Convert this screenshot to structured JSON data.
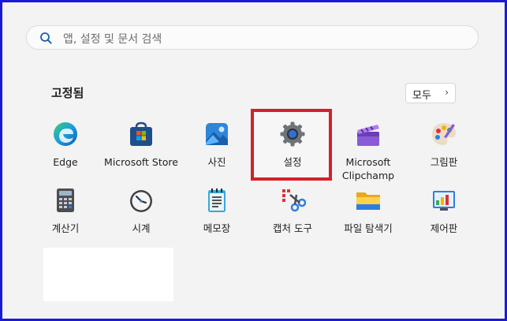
{
  "search": {
    "placeholder": "앱, 설정 및 문서 검색",
    "icon": "search-icon"
  },
  "pinned": {
    "title": "고정됨",
    "all_label": "모두",
    "apps": [
      {
        "label": "Edge",
        "icon": "edge-icon"
      },
      {
        "label": "Microsoft Store",
        "icon": "store-icon"
      },
      {
        "label": "사진",
        "icon": "photos-icon"
      },
      {
        "label": "설정",
        "icon": "gear-icon"
      },
      {
        "label_line1": "Microsoft",
        "label_line2": "Clipchamp",
        "icon": "clipchamp-icon"
      },
      {
        "label": "그림판",
        "icon": "paint-icon"
      },
      {
        "label": "계산기",
        "icon": "calculator-icon"
      },
      {
        "label": "시계",
        "icon": "clock-icon"
      },
      {
        "label": "메모장",
        "icon": "notepad-icon"
      },
      {
        "label": "캡처 도구",
        "icon": "snipping-tool-icon"
      },
      {
        "label": "파일 탐색기",
        "icon": "folder-icon"
      },
      {
        "label": "제어판",
        "icon": "control-panel-icon"
      }
    ]
  },
  "colors": {
    "highlight": "#d3202a",
    "frame": "#1a1ad6"
  }
}
